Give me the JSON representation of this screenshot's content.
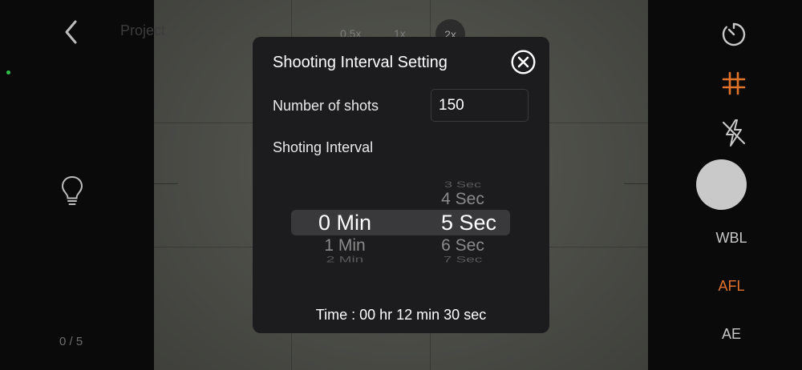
{
  "nav": {
    "project_label": "Project"
  },
  "zoom": {
    "opt_05": "0.5x",
    "opt_1": "1x",
    "opt_2": "2x",
    "selected": "2x"
  },
  "sidebar_left": {
    "counter": "0 / 5"
  },
  "sidebar_right": {
    "wb_label": "WBL",
    "af_label": "AFL",
    "ae_label": "AE",
    "accent_color": "#e0722c"
  },
  "dialog": {
    "title": "Shooting Interval Setting",
    "shots_label": "Number of shots",
    "shots_value": "150",
    "interval_label": "Shoting Interval",
    "minutes": {
      "prev2": "",
      "prev1": "",
      "selected": "0 Min",
      "next1": "1 Min",
      "next2": "2 Min"
    },
    "seconds": {
      "prev2": "3 Sec",
      "prev1": "4 Sec",
      "selected": "5 Sec",
      "next1": "6 Sec",
      "next2": "7 Sec"
    },
    "time_summary": "Time : 00 hr 12 min 30 sec"
  },
  "icons": {
    "back": "chevron-left-icon",
    "bulb": "lightbulb-icon",
    "timer": "timer-icon",
    "grid": "grid-icon",
    "flash": "flash-off-icon",
    "close": "close-circle-icon"
  }
}
